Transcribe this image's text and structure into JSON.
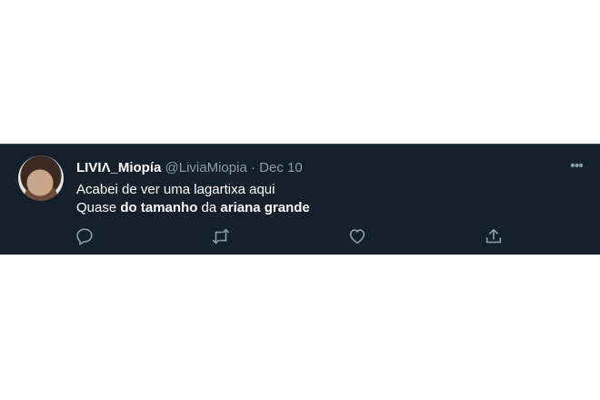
{
  "tweet": {
    "display_name": "LIVIΛ_Miopía",
    "handle": "@LiviaMiopia",
    "separator": "·",
    "date": "Dec 10",
    "line1": "Acabei de ver uma lagartixa aqui",
    "line2": {
      "part1": "Quase ",
      "bold1": "do tamanho",
      "part2": " da ",
      "bold2": "ariana grande"
    },
    "more_label": "•••"
  },
  "icons": {
    "reply": "reply-icon",
    "retweet": "retweet-icon",
    "like": "like-icon",
    "share": "share-icon",
    "more": "more-icon"
  },
  "colors": {
    "background": "#15202b",
    "secondary_text": "#8899a6",
    "primary_text": "#ffffff"
  }
}
